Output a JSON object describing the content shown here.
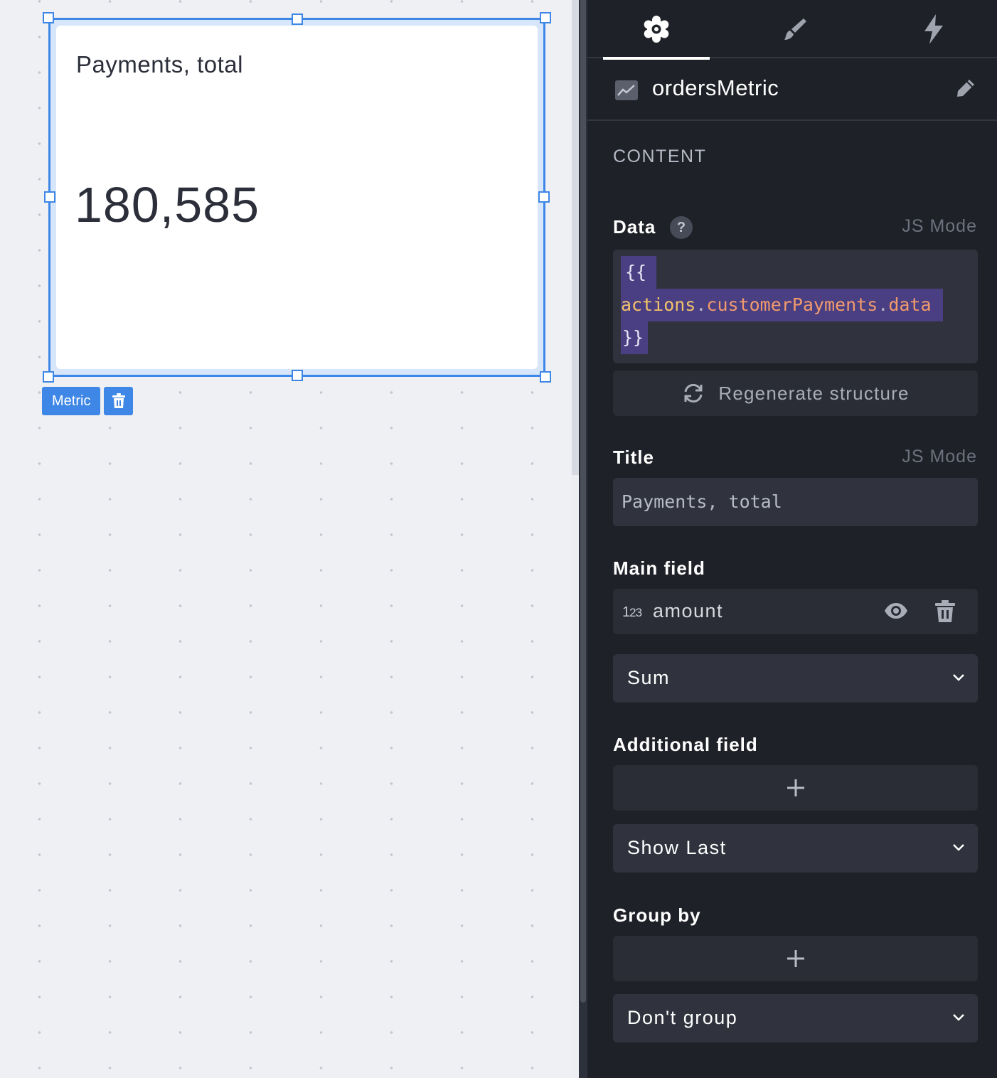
{
  "canvas": {
    "widget": {
      "title": "Payments, total",
      "value": "180,585",
      "type_label": "Metric"
    }
  },
  "panel": {
    "tabs": [
      {
        "name": "settings",
        "icon": "gear-icon",
        "active": true
      },
      {
        "name": "style",
        "icon": "brush-icon",
        "active": false
      },
      {
        "name": "actions",
        "icon": "lightning-icon",
        "active": false
      }
    ],
    "widget_name": "ordersMetric",
    "section": "CONTENT",
    "data": {
      "label": "Data",
      "help": "?",
      "js_mode": "JS Mode",
      "code_open": "{{",
      "code_object": "actions",
      "code_dot1": ".",
      "code_prop1": "customerPayments",
      "code_dot2": ".",
      "code_prop2": "data",
      "code_close": "}}"
    },
    "regenerate_label": "Regenerate structure",
    "title": {
      "label": "Title",
      "js_mode": "JS Mode",
      "value": "Payments, total"
    },
    "main_field": {
      "label": "Main field",
      "type_badge_main": "1",
      "type_badge_sub": "23",
      "field_name": "amount",
      "aggregation": "Sum"
    },
    "additional_field": {
      "label": "Additional field",
      "mode": "Show Last"
    },
    "group_by": {
      "label": "Group by",
      "mode": "Don't group"
    },
    "colors": {
      "selection": "#3f87e6",
      "panel_bg": "#1f2128",
      "code_highlight": "#4b3f83"
    }
  }
}
